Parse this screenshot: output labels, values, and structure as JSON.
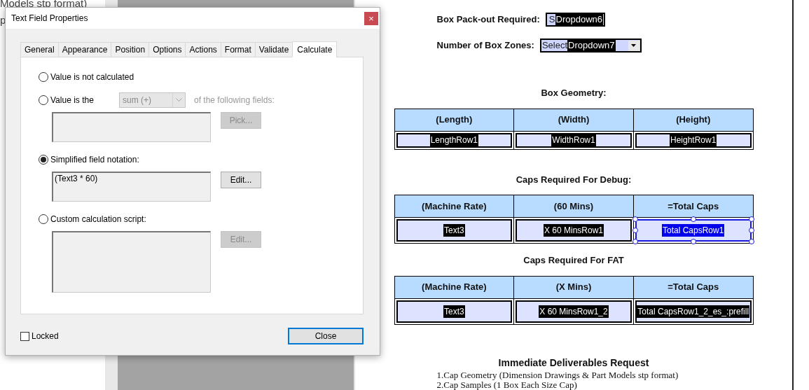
{
  "background_text": [
    "Models stp format)",
    "p"
  ],
  "dialog": {
    "title": "Text Field Properties",
    "close_glyph": "×",
    "tabs": [
      {
        "label": "General",
        "selected": false
      },
      {
        "label": "Appearance",
        "selected": false
      },
      {
        "label": "Position",
        "selected": false
      },
      {
        "label": "Options",
        "selected": false
      },
      {
        "label": "Actions",
        "selected": false
      },
      {
        "label": "Format",
        "selected": false
      },
      {
        "label": "Validate",
        "selected": false
      },
      {
        "label": "Calculate",
        "selected": true
      }
    ],
    "options": [
      {
        "kind": "plain",
        "label": "Value is not calculated",
        "selected": false
      },
      {
        "kind": "aggregate",
        "selected": false,
        "label": "Value is the",
        "dropdown": "sum (+)",
        "suffix": "of the following fields:",
        "button": "Pick...",
        "disabled": true
      },
      {
        "kind": "notation",
        "label": "Simplified field notation:",
        "value": "(Text3 * 60)",
        "button": "Edit...",
        "disabled": false,
        "selected": true
      },
      {
        "kind": "script",
        "label": "Custom calculation script:",
        "button": "Edit...",
        "disabled": true,
        "selected": false
      }
    ],
    "locked": {
      "label": "Locked",
      "checked": false
    },
    "close_button": "Close"
  },
  "document": {
    "fields": [
      {
        "label": "Box Pack-out Required:",
        "prefix": "S",
        "value": "Dropdown6",
        "arrow": false
      },
      {
        "label": "Number of Box Zones:",
        "prefix": "Select",
        "value": "Dropdown7",
        "arrow": true
      }
    ],
    "tables": [
      {
        "title": "Box Geometry:",
        "columns": [
          "(Length)",
          "(Width)",
          "(Height)"
        ],
        "cells": [
          {
            "text": "LengthRow1",
            "selected": false
          },
          {
            "text": "WidthRow1",
            "selected": false
          },
          {
            "text": "HeightRow1",
            "selected": false
          }
        ]
      },
      {
        "title": "Caps Required For Debug:",
        "columns": [
          "(Machine Rate)",
          "(60 Mins)",
          "=Total Caps"
        ],
        "cells": [
          {
            "text": "Text3",
            "selected": false
          },
          {
            "text": "X 60 MinsRow1",
            "selected": false
          },
          {
            "text": "Total CapsRow1",
            "selected": true
          }
        ]
      },
      {
        "title": "Caps Required For FAT",
        "columns": [
          "(Machine Rate)",
          "(X Mins)",
          "=Total Caps"
        ],
        "cells": [
          {
            "text": "Text3",
            "selected": false
          },
          {
            "text": "X 60 MinsRow1_2",
            "selected": false
          },
          {
            "text": "Total CapsRow1_2_es_:prefill",
            "selected": false
          }
        ]
      }
    ],
    "deliverables": {
      "title": "Immediate Deliverables Request",
      "items": [
        "1.Cap Geometry (Dimension Drawings & Part Models stp format)",
        "2.Cap Samples (1 Box Each Size Cap)"
      ]
    }
  }
}
